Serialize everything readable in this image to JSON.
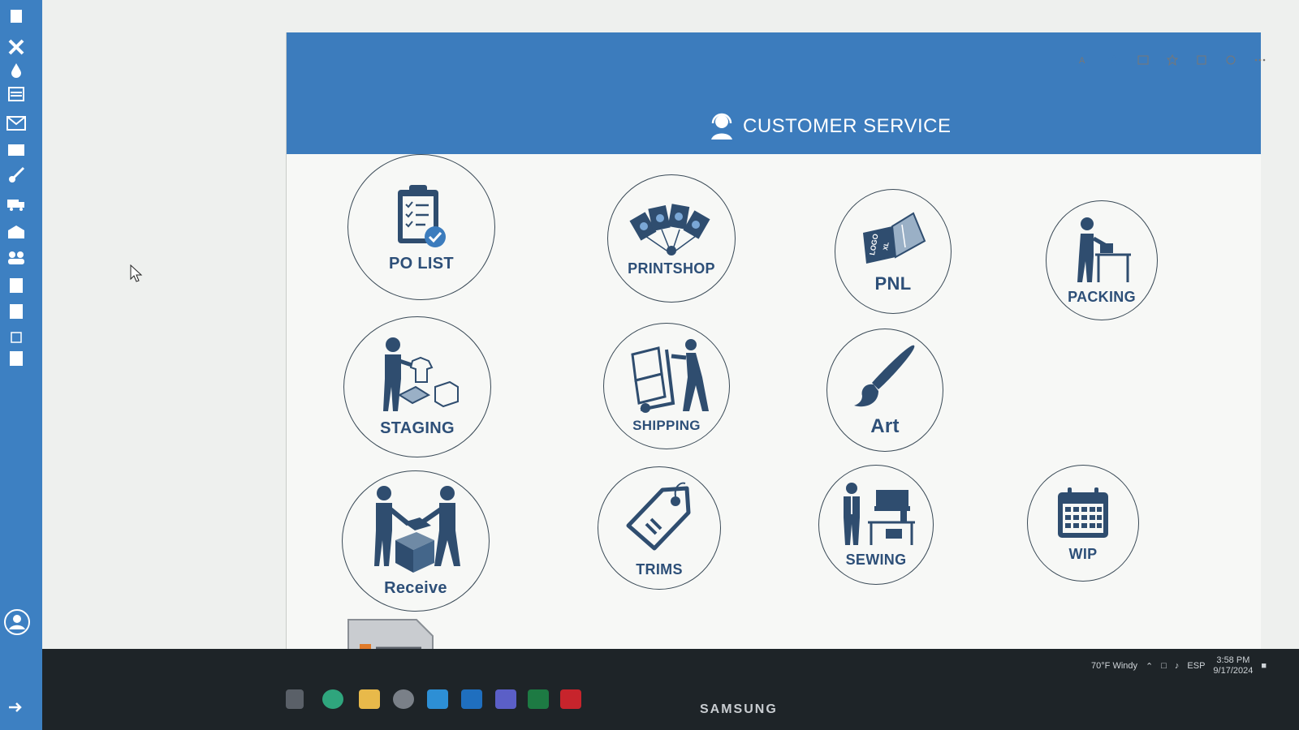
{
  "header": {
    "title": "CUSTOMER SERVICE"
  },
  "tiles": {
    "po_list": "PO LIST",
    "printshop": "PRINTSHOP",
    "pnl": "PNL",
    "packing": "PACKING",
    "staging": "STAGING",
    "shipping": "SHIPPING",
    "art": "Art",
    "receive": "Receive",
    "trims": "TRIMS",
    "sewing": "SEWING",
    "wip": "WIP"
  },
  "pnl_icon_text": {
    "logo": "LOGO",
    "size": "XL"
  },
  "taskbar": {
    "weather": "70°F  Windy",
    "language": "ESP",
    "time": "3:58 PM",
    "date": "9/17/2024",
    "monitor_brand": "SAMSUNG"
  },
  "colors": {
    "accent": "#3c7cbd",
    "label": "#2d4f78",
    "sidebar": "#3d80c2"
  }
}
